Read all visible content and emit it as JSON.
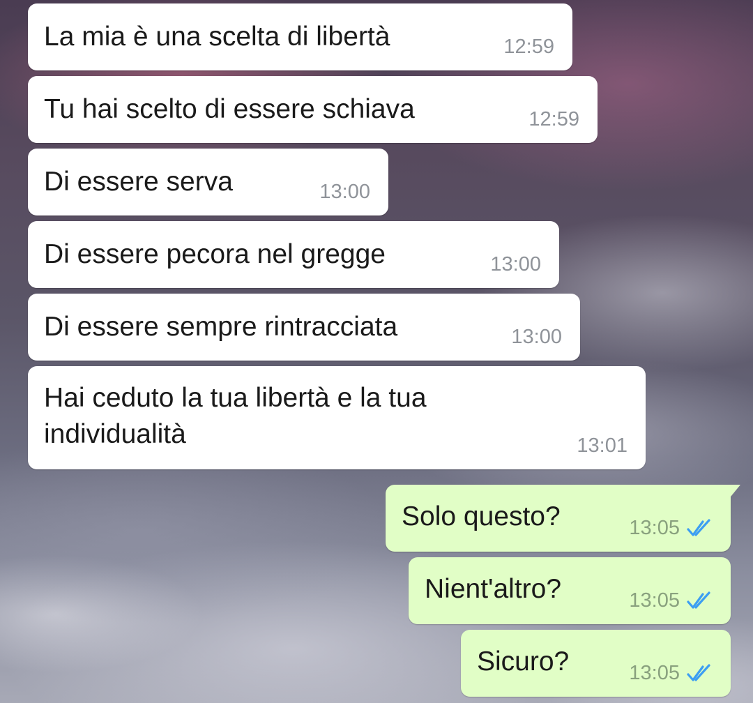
{
  "chat": {
    "messages": [
      {
        "direction": "incoming",
        "text": "La mia è una scelta di libertà",
        "time": "12:59"
      },
      {
        "direction": "incoming",
        "text": "Tu hai scelto di essere schiava",
        "time": "12:59"
      },
      {
        "direction": "incoming",
        "text": "Di essere serva",
        "time": "13:00"
      },
      {
        "direction": "incoming",
        "text": "Di essere pecora nel gregge",
        "time": "13:00"
      },
      {
        "direction": "incoming",
        "text": "Di essere sempre rintracciata",
        "time": "13:00"
      },
      {
        "direction": "incoming",
        "text": "Hai ceduto la tua libertà e la tua\nindividualità",
        "time": "13:01"
      },
      {
        "direction": "outgoing",
        "text": "Solo questo?",
        "time": "13:05",
        "status_icon": "double-check-read-icon"
      },
      {
        "direction": "outgoing",
        "text": "Nient'altro?",
        "time": "13:05",
        "status_icon": "double-check-read-icon"
      },
      {
        "direction": "outgoing",
        "text": "Sicuro?",
        "time": "13:05",
        "status_icon": "double-check-read-icon"
      }
    ]
  },
  "theme": {
    "incoming_bubble": "#ffffff",
    "outgoing_bubble": "#e1fec6",
    "read_tick_color": "#3c9ef2",
    "timestamp_color": "#8f9399"
  }
}
